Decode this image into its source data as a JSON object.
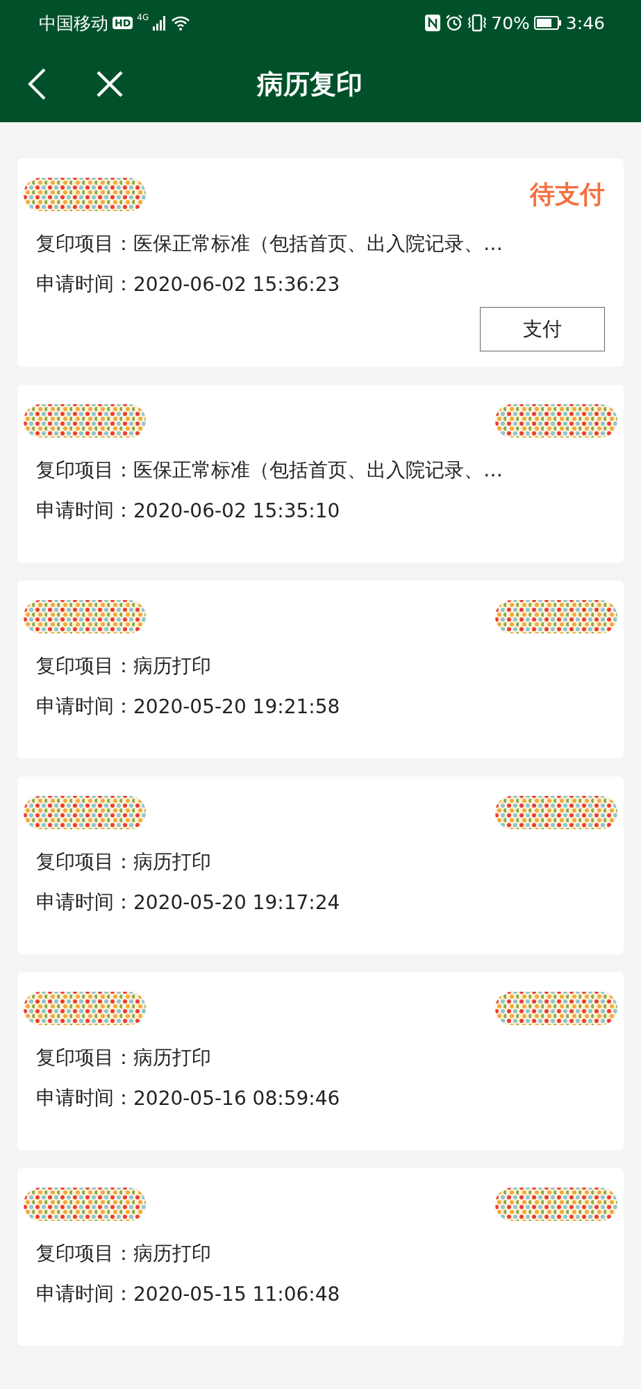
{
  "status_bar": {
    "carrier": "中国移动",
    "hd": "HD",
    "network": "4G",
    "battery": "70%",
    "time": "3:46"
  },
  "header": {
    "title": "病历复印"
  },
  "records": [
    {
      "item_label": "复印项目：",
      "item": "医保正常标准（包括首页、出入院记录、…",
      "time_label": "申请时间：",
      "time": "2020-06-02 15:36:23",
      "status": "待支付",
      "action": "支付"
    },
    {
      "item_label": "复印项目：",
      "item": "医保正常标准（包括首页、出入院记录、…",
      "time_label": "申请时间：",
      "time": "2020-06-02 15:35:10"
    },
    {
      "item_label": "复印项目：",
      "item": "病历打印",
      "time_label": "申请时间：",
      "time": "2020-05-20 19:21:58"
    },
    {
      "item_label": "复印项目：",
      "item": "病历打印",
      "time_label": "申请时间：",
      "time": "2020-05-20 19:17:24"
    },
    {
      "item_label": "复印项目：",
      "item": "病历打印",
      "time_label": "申请时间：",
      "time": "2020-05-16 08:59:46"
    },
    {
      "item_label": "复印项目：",
      "item": "病历打印",
      "time_label": "申请时间：",
      "time": "2020-05-15 11:06:48"
    }
  ]
}
